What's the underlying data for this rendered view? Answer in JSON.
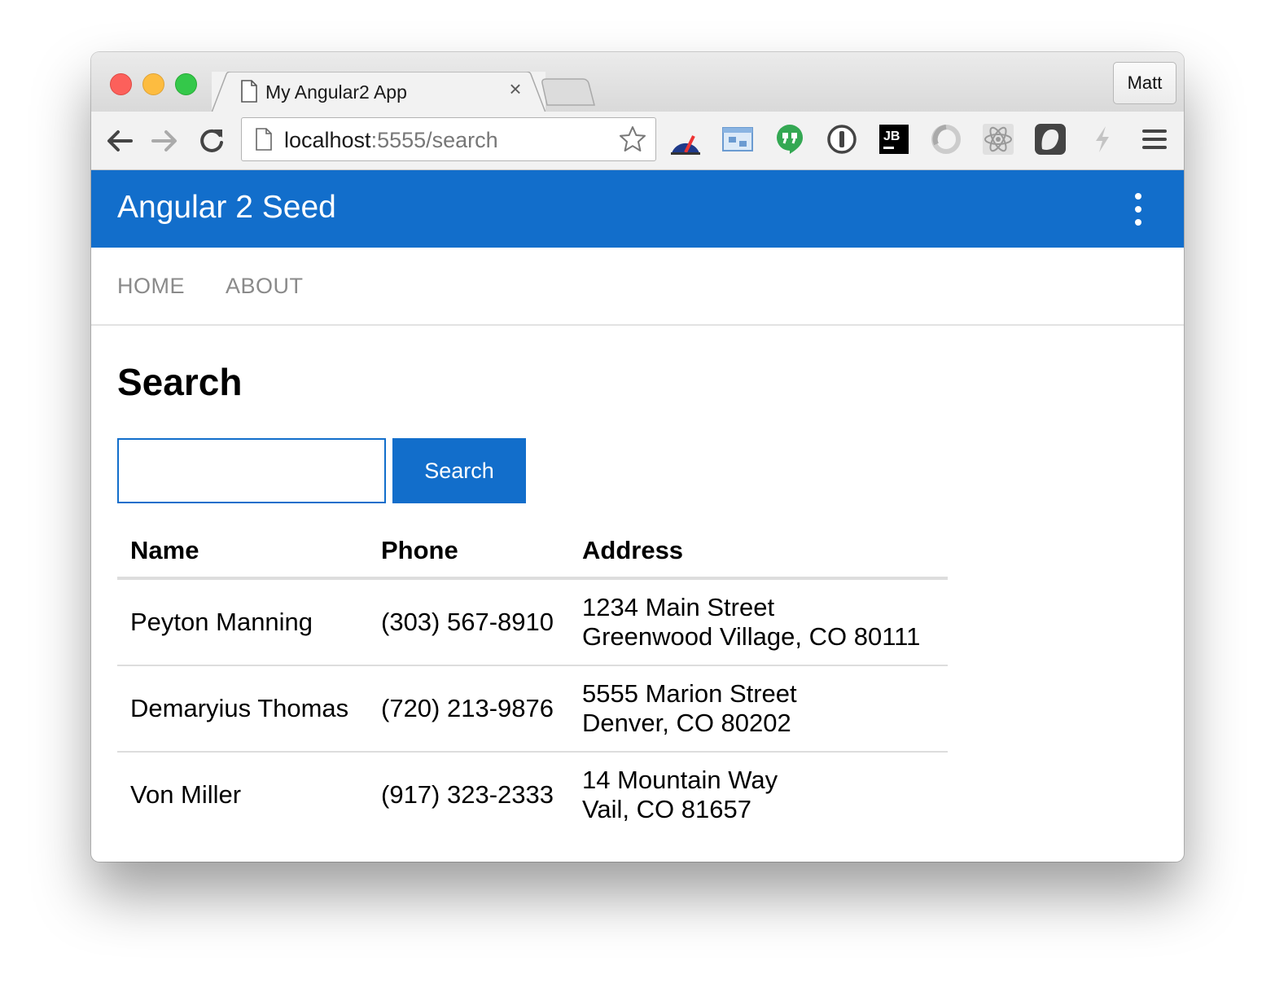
{
  "browser": {
    "tab_title": "My Angular2 App",
    "tab_close": "×",
    "profile_name": "Matt",
    "url_host": "localhost",
    "url_path": ":5555/search",
    "extensions": [
      "speedometer-extension-icon",
      "screen-capture-extension-icon",
      "hangouts-extension-icon",
      "1password-extension-icon",
      "jetbrains-extension-icon",
      "wappalyzer-extension-icon",
      "react-devtools-extension-icon",
      "ghostery-extension-icon",
      "lightning-extension-icon"
    ]
  },
  "app": {
    "title": "Angular 2 Seed",
    "nav": [
      {
        "label": "HOME"
      },
      {
        "label": "ABOUT"
      }
    ]
  },
  "page": {
    "heading": "Search",
    "search": {
      "value": "",
      "placeholder": "",
      "button_label": "Search"
    },
    "table": {
      "columns": [
        "Name",
        "Phone",
        "Address"
      ],
      "rows": [
        {
          "name": "Peyton Manning",
          "phone": "(303) 567-8910",
          "address": [
            "1234 Main Street",
            "Greenwood Village, CO 80111"
          ]
        },
        {
          "name": "Demaryius Thomas",
          "phone": "(720) 213-9876",
          "address": [
            "5555 Marion Street",
            "Denver, CO 80202"
          ]
        },
        {
          "name": "Von Miller",
          "phone": "(917) 323-2333",
          "address": [
            "14 Mountain Way",
            "Vail, CO 81657"
          ]
        }
      ]
    }
  },
  "colors": {
    "primary": "#126ecb",
    "nav_text": "#8a8a8a",
    "border": "#dddddd"
  }
}
